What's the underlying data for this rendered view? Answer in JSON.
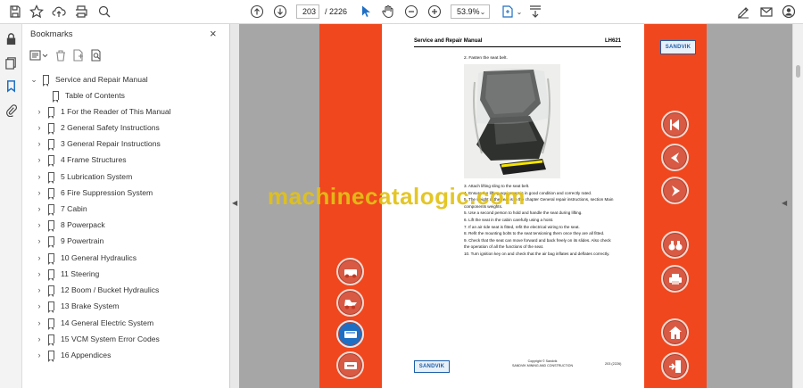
{
  "toolbar": {
    "page_current": "203",
    "page_total": "/ 2226",
    "zoom": "53.9%"
  },
  "panel": {
    "title": "Bookmarks",
    "close": "×",
    "bookmarks": [
      {
        "label": "Service and Repair Manual",
        "chevron": "⌄"
      },
      {
        "label": "Table of Contents",
        "chevron": ""
      },
      {
        "label": "1 For the Reader of This Manual",
        "chevron": "›"
      },
      {
        "label": "2 General Safety Instructions",
        "chevron": "›"
      },
      {
        "label": "3 General Repair Instructions",
        "chevron": "›"
      },
      {
        "label": "4 Frame Structures",
        "chevron": "›"
      },
      {
        "label": "5 Lubrication System",
        "chevron": "›"
      },
      {
        "label": "6 Fire Suppression System",
        "chevron": "›"
      },
      {
        "label": "7 Cabin",
        "chevron": "›"
      },
      {
        "label": "8 Powerpack",
        "chevron": "›"
      },
      {
        "label": "9 Powertrain",
        "chevron": "›"
      },
      {
        "label": "10 General Hydraulics",
        "chevron": "›"
      },
      {
        "label": "11 Steering",
        "chevron": "›"
      },
      {
        "label": "12 Boom / Bucket Hydraulics",
        "chevron": "›"
      },
      {
        "label": "13 Brake System",
        "chevron": "›"
      },
      {
        "label": "14 General Electric System",
        "chevron": "›"
      },
      {
        "label": "15 VCM System Error Codes",
        "chevron": "›"
      },
      {
        "label": "16 Appendices",
        "chevron": "›"
      }
    ]
  },
  "document": {
    "header_left": "Service and Repair Manual",
    "header_right": "LH621",
    "step_fasten": "2. Fasten the seat belt.",
    "steps": [
      "3. Attach lifting sling to the seat belt.",
      "4. Ensure the lifting equipment is in good condition and correctly rated.",
      "5. The weight of the seat is in the chapter General repair instructions, section Main components weights.",
      "5. Use a second person to hold and handle the seat during lifting.",
      "6. Lift the seat in the cabin carefully using a hoist.",
      "7. If an air ride seat is fitted, refit the electrical wiring to the seat.",
      "8. Refit the mounting bolts to the seat tensioning them once they are all fitted.",
      "9. Check that the seat can move forward and back freely on its slides. Also check the operation of all the functions of the seat.",
      "10. Turn ignition key on and check that the air bag inflates and deflates correctly."
    ],
    "footer_copy": "Copyright © Sandvik",
    "footer_sub": "SANDVIK MINING AND CONSTRUCTION",
    "page_number": "203 (2226)",
    "brand": "SANDVIK",
    "watermark": "machinecatalogic.com"
  },
  "colors": {
    "accent_orange": "#f0471e",
    "brand_blue": "#1d5fa8",
    "watermark": "#e2c215"
  }
}
